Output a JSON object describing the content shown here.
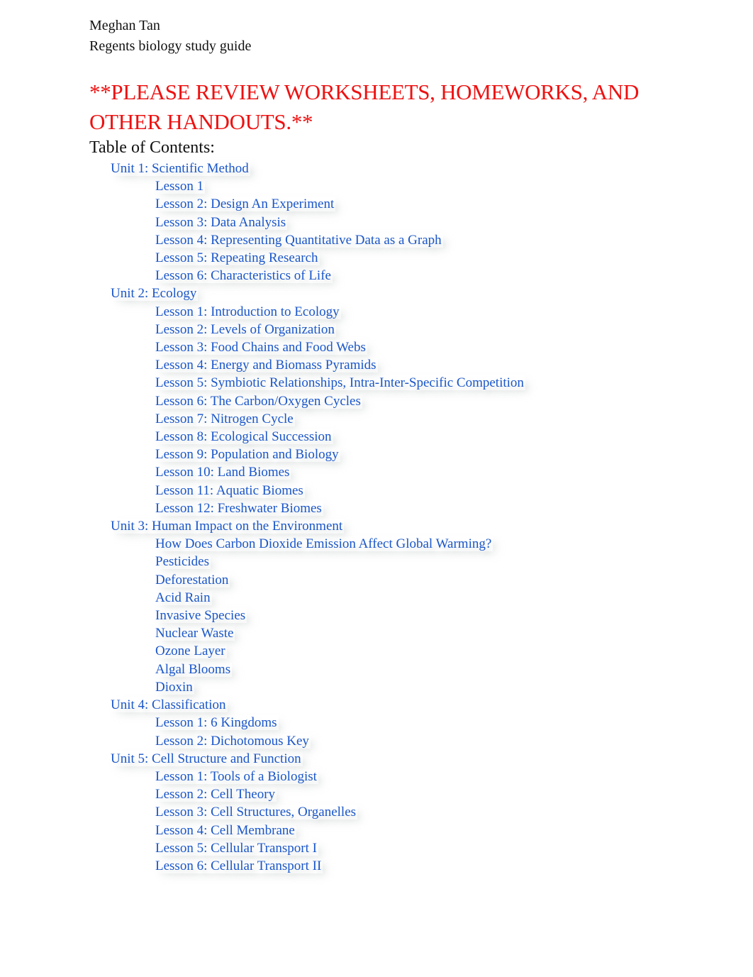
{
  "header": {
    "author": "Meghan Tan",
    "doc_title": "Regents biology study guide"
  },
  "notice": "**PLEASE REVIEW WORKSHEETS, HOMEWORKS, AND OTHER HANDOUTS.**",
  "toc": {
    "title": "Table of Contents:",
    "units": [
      {
        "label": "Unit 1: Scientific Method",
        "lessons": [
          "Lesson 1",
          "Lesson 2: Design An Experiment",
          "Lesson 3: Data Analysis",
          "Lesson 4: Representing Quantitative Data as a Graph",
          "Lesson 5: Repeating Research",
          "Lesson 6: Characteristics of Life"
        ]
      },
      {
        "label": "Unit 2: Ecology",
        "lessons": [
          "Lesson 1: Introduction to Ecology",
          "Lesson 2: Levels of Organization",
          "Lesson 3: Food Chains and Food Webs",
          "Lesson 4: Energy and Biomass Pyramids",
          "Lesson 5: Symbiotic Relationships, Intra-Inter-Specific Competition",
          "Lesson 6: The Carbon/Oxygen Cycles",
          "Lesson 7: Nitrogen Cycle",
          "Lesson 8: Ecological Succession",
          "Lesson 9: Population and Biology",
          "Lesson 10: Land Biomes",
          "Lesson 11: Aquatic Biomes",
          "Lesson 12: Freshwater Biomes"
        ]
      },
      {
        "label": "Unit 3: Human Impact on the Environment",
        "lessons": [
          "How Does Carbon Dioxide Emission Affect Global Warming?",
          "Pesticides",
          "Deforestation",
          "Acid Rain",
          "Invasive Species",
          "Nuclear Waste",
          "Ozone Layer",
          "Algal Blooms",
          "Dioxin"
        ]
      },
      {
        "label": "Unit 4: Classification",
        "lessons": [
          "Lesson 1: 6 Kingdoms",
          "Lesson 2: Dichotomous Key"
        ]
      },
      {
        "label": "Unit 5: Cell Structure and Function",
        "lessons": [
          "Lesson 1: Tools of a Biologist",
          "Lesson 2: Cell Theory",
          "Lesson 3: Cell Structures, Organelles",
          "Lesson 4: Cell Membrane",
          "Lesson 5: Cellular Transport I",
          "Lesson 6: Cellular Transport II"
        ]
      }
    ]
  },
  "colors": {
    "notice": "#ee1111",
    "link": "#1a56c9",
    "text": "#111111"
  }
}
